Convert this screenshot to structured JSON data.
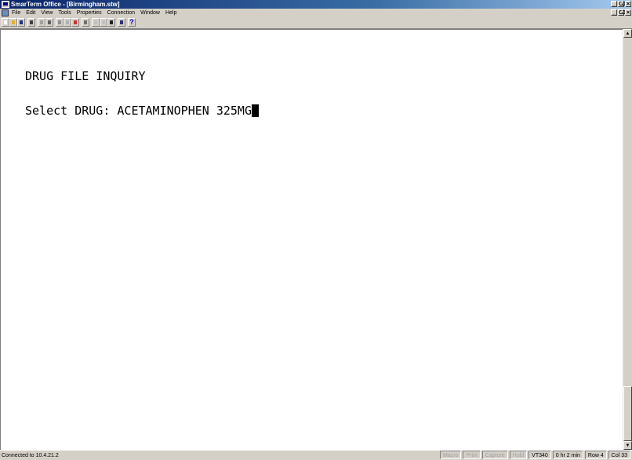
{
  "window": {
    "title": "SmarTerm Office - [Birmingham.stw]",
    "controls": {
      "minimize": "_",
      "maximize": "Ѡ",
      "close": "×"
    }
  },
  "menu": {
    "items": [
      "File",
      "Edit",
      "View",
      "Tools",
      "Properties",
      "Connection",
      "Window",
      "Help"
    ]
  },
  "toolbar": {
    "help_label": "?"
  },
  "terminal": {
    "line1": "DRUG FILE INQUIRY",
    "line2": "Select DRUG: ACETAMINOPHEN 325MG"
  },
  "status": {
    "connection": "Connected to 10.4.21.2",
    "macro": "Macro",
    "print": "Print",
    "capture": "Capture",
    "hold": "Hold",
    "emulation": "VT340",
    "elapsed": "0 hr 2 min",
    "row": "Row 4",
    "col": "Col 33"
  },
  "scroll": {
    "up": "▲",
    "down": "▼"
  },
  "colors": {
    "title_start": "#0a246a",
    "title_end": "#a6caf0",
    "chrome": "#d4d0c8",
    "terminal_bg": "#ffffff"
  }
}
